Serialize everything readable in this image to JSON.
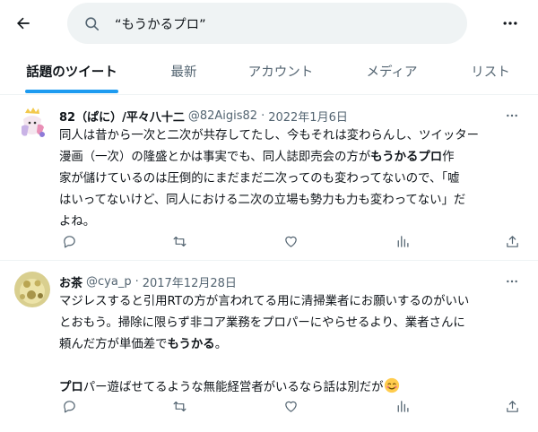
{
  "search": {
    "query": "“もうかるプロ”"
  },
  "icons": {
    "back": "arrow-left-icon",
    "search": "search-icon",
    "more": "more-icon"
  },
  "tabs": [
    {
      "label": "話題のツイート",
      "active": true
    },
    {
      "label": "最新"
    },
    {
      "label": "アカウント"
    },
    {
      "label": "メディア"
    },
    {
      "label": "リスト"
    }
  ],
  "tweets": [
    {
      "name": "82（ぱに）/平々八十二",
      "handle": "@82Aigis82",
      "sep": "·",
      "date": "2022年1月6日",
      "lines": [
        {
          "a": "同人は昔から一次と二次が共存してたし、今もそれは変わらんし、ツイッター"
        },
        {
          "a": "漫画（一次）の隆盛とかは事実でも、同人誌即売会の方が",
          "b": "もうかるプロ",
          "c": "作"
        },
        {
          "a": "家が儲けているのは圧倒的にまだまだ二次ってのも変わってないので、「嘘"
        },
        {
          "a": "はいってないけど、同人における二次の立場も勢力も力も変わってない」だ"
        },
        {
          "a": "よね。"
        }
      ]
    },
    {
      "name": "お茶",
      "handle": "@cya_p",
      "sep": "·",
      "date": "2017年12月28日",
      "lines": [
        {
          "a": "マジレスすると引用RTの方が言われてる用に清掃業者にお願いするのがいい"
        },
        {
          "a": "とおもう。掃除に限らず非コア業務をプロパーにやらせるより、業者さんに"
        },
        {
          "a": "頼んだ方が単価差で",
          "b": "もうかる",
          "c": "。"
        },
        {
          "a": ""
        },
        {
          "b": "プロ",
          "c": "パー遊ばせてるような無能経営者がいるなら話は別だが"
        }
      ]
    }
  ],
  "accent_color": "#1d9bf0"
}
